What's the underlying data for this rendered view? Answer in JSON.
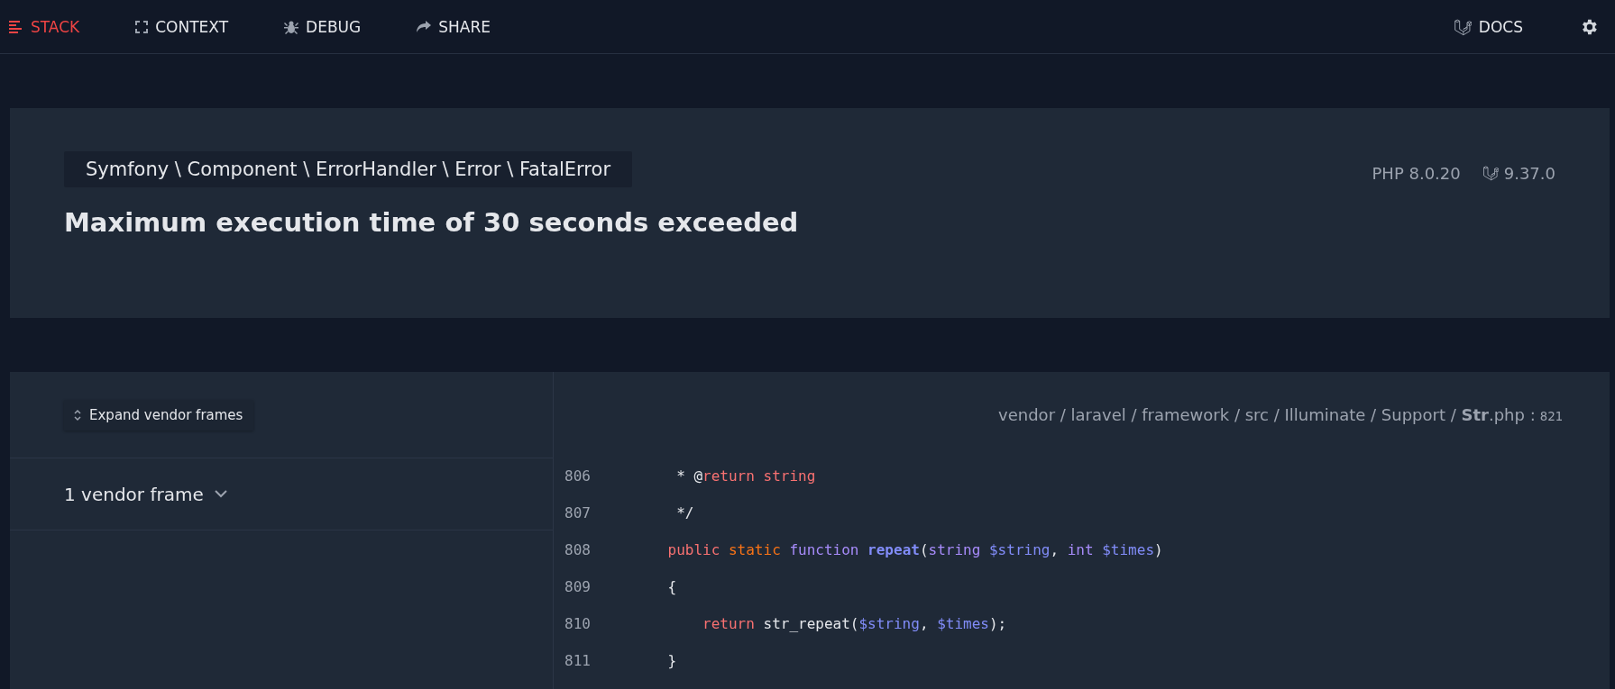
{
  "nav": {
    "tabs": [
      {
        "label": "STACK",
        "selected": true
      },
      {
        "label": "CONTEXT",
        "selected": false
      },
      {
        "label": "DEBUG",
        "selected": false
      },
      {
        "label": "SHARE",
        "selected": false
      }
    ],
    "docs": {
      "label": "DOCS"
    }
  },
  "error": {
    "exception_class": "Symfony \\ Component \\ ErrorHandler \\ Error \\ FatalError",
    "message": "Maximum execution time of 30 seconds exceeded",
    "php_version": "PHP 8.0.20",
    "laravel_version": "9.37.0"
  },
  "stack": {
    "expand_button": "Expand vendor frames",
    "frame_groups": [
      {
        "label": "1 vendor frame",
        "expanded": false
      }
    ]
  },
  "code": {
    "path": "vendor / laravel / framework / src / Illuminate / Support / **Str**.php :",
    "line": "821",
    "lines": [
      {
        "number": "806",
        "tokens": [
          {
            "text": "     * @",
            "kind": "plain"
          },
          {
            "text": "return string",
            "kind": "keyword"
          }
        ]
      },
      {
        "number": "807",
        "tokens": [
          {
            "text": "     */",
            "kind": "plain"
          }
        ]
      },
      {
        "number": "808",
        "tokens": [
          {
            "text": "    public",
            "kind": "keyword"
          },
          {
            "text": " static",
            "kind": "modifier"
          },
          {
            "text": " function",
            "kind": "type"
          },
          {
            "text": " repeat",
            "kind": "name"
          },
          {
            "text": "(",
            "kind": "plain"
          },
          {
            "text": "string",
            "kind": "type"
          },
          {
            "text": " $string",
            "kind": "variable"
          },
          {
            "text": ", ",
            "kind": "plain"
          },
          {
            "text": "int",
            "kind": "type"
          },
          {
            "text": " $times",
            "kind": "variable"
          },
          {
            "text": ")",
            "kind": "plain"
          }
        ]
      },
      {
        "number": "809",
        "tokens": [
          {
            "text": "    {",
            "kind": "plain"
          }
        ]
      },
      {
        "number": "810",
        "tokens": [
          {
            "text": "        return",
            "kind": "keyword"
          },
          {
            "text": " str_repeat(",
            "kind": "plain"
          },
          {
            "text": "$string",
            "kind": "variable"
          },
          {
            "text": ", ",
            "kind": "plain"
          },
          {
            "text": "$times",
            "kind": "variable"
          },
          {
            "text": ");",
            "kind": "plain"
          }
        ]
      },
      {
        "number": "811",
        "tokens": [
          {
            "text": "    }",
            "kind": "plain"
          }
        ]
      }
    ]
  }
}
